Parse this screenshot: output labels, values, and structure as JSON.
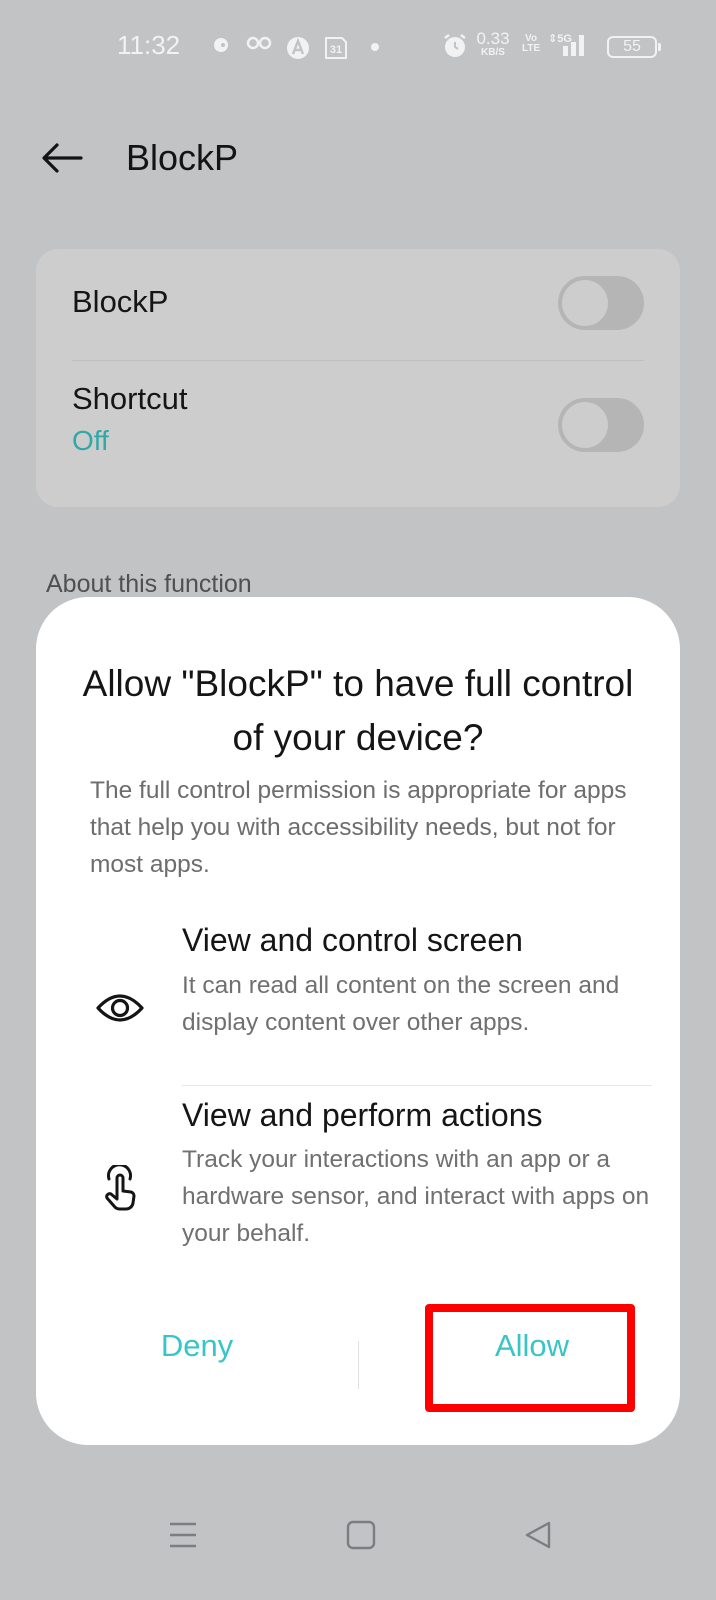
{
  "status_bar": {
    "time": "11:32",
    "net_speed_value": "0.33",
    "net_speed_unit": "KB/S",
    "volte_top": "Vo",
    "volte_bottom": "LTE",
    "network_type": "5G",
    "battery_level": "55",
    "calendar_day": "31",
    "icons": [
      "app-notification-icon",
      "glasses-icon",
      "app-a-icon",
      "calendar-icon",
      "dot-icon",
      "alarm-icon",
      "signal-icon",
      "battery-icon"
    ]
  },
  "app_bar": {
    "title": "BlockP",
    "back_icon": "arrow-left-icon"
  },
  "settings": {
    "rows": [
      {
        "label": "BlockP",
        "toggle_on": false
      },
      {
        "label": "Shortcut",
        "subtitle": "Off",
        "toggle_on": false
      }
    ],
    "section_title": "About this function"
  },
  "dialog": {
    "title": "Allow \"BlockP\" to have full control of your device?",
    "body": "The full control permission is appropriate for apps that help you with accessibility needs, but not for most apps.",
    "permissions": [
      {
        "icon": "eye-icon",
        "title": "View and control screen",
        "description": "It can read all content on the screen and display content over other apps."
      },
      {
        "icon": "touch-hand-icon",
        "title": "View and perform actions",
        "description": "Track your interactions with an app or a hardware sensor, and interact with apps on your behalf."
      }
    ],
    "deny_label": "Deny",
    "allow_label": "Allow"
  },
  "colors": {
    "accent": "#39c5c8",
    "subtitle_accent": "#2fa9a6",
    "highlight": "#ff0000",
    "background": "#c2c3c5",
    "dialog": "#ffffff"
  },
  "nav_bar": {
    "items": [
      "recents-menu-icon",
      "home-square-icon",
      "back-triangle-icon"
    ]
  }
}
